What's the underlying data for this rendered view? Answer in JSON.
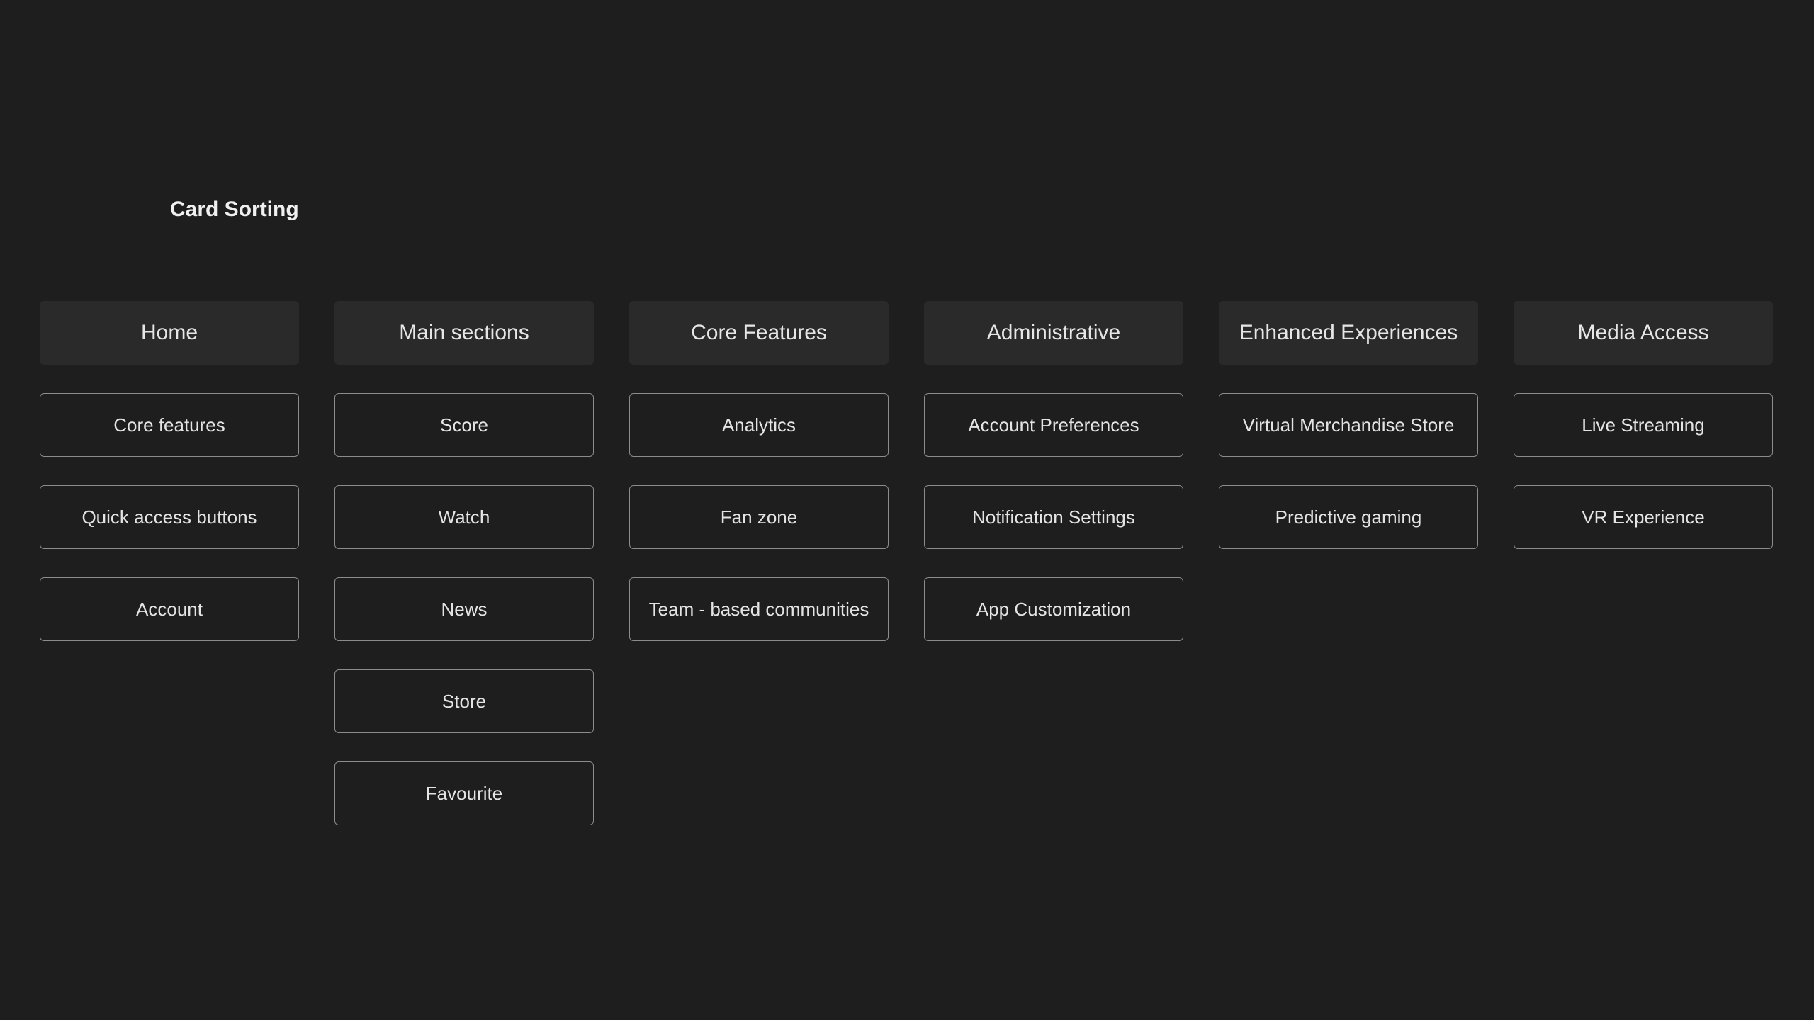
{
  "page": {
    "title": "Card Sorting"
  },
  "columns": [
    {
      "header": "Home",
      "cards": [
        "Core features",
        "Quick access buttons",
        "Account"
      ]
    },
    {
      "header": "Main sections",
      "cards": [
        "Score",
        "Watch",
        "News",
        "Store",
        "Favourite"
      ]
    },
    {
      "header": "Core Features",
      "cards": [
        "Analytics",
        "Fan zone",
        "Team - based communities"
      ]
    },
    {
      "header": "Administrative",
      "cards": [
        "Account Preferences",
        "Notification Settings",
        "App Customization"
      ]
    },
    {
      "header": "Enhanced Experiences",
      "cards": [
        "Virtual Merchandise Store",
        "Predictive gaming"
      ]
    },
    {
      "header": "Media Access",
      "cards": [
        "Live Streaming",
        "VR Experience"
      ]
    }
  ],
  "colors": {
    "background": "#1e1e1e",
    "header_background": "#2a2a2a",
    "card_border": "#8c8c8c",
    "text": "#e8e8e8"
  }
}
